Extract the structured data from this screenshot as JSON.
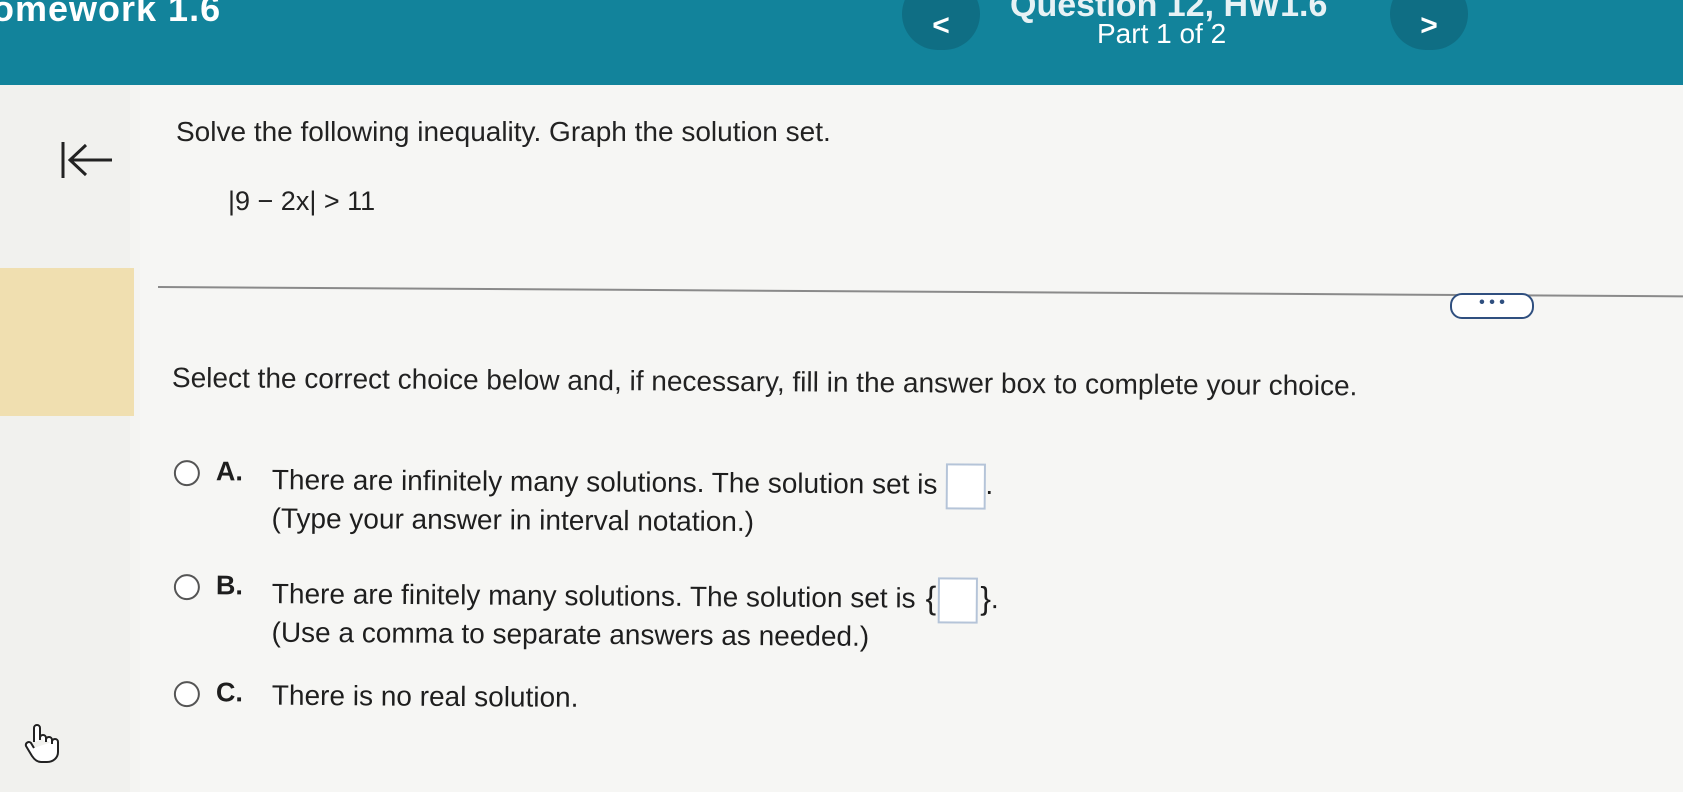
{
  "header": {
    "assignment_title": "omework 1.6",
    "question_title": "Question 12, HW1.6",
    "part_label": "Part 1 of 2",
    "prev_label": "<",
    "next_label": ">"
  },
  "sidebar": {
    "back_icon": "collapse-left-arrow-icon",
    "hand_icon": "hand-pointer-icon"
  },
  "problem": {
    "instruction": "Solve the following inequality. Graph the solution set.",
    "equation": "|9 − 2x| > 11"
  },
  "more_button_label": "• • •",
  "prompt": "Select the correct choice below and, if necessary, fill in the answer box to complete your choice.",
  "choices": [
    {
      "letter": "A.",
      "text": "There are infinitely many solutions. The solution set is",
      "hint": "(Type your answer in interval notation.)",
      "answer_value": ""
    },
    {
      "letter": "B.",
      "text": "There are finitely many solutions. The solution set is",
      "hint": "(Use a comma to separate answers as needed.)",
      "answer_value": ""
    },
    {
      "letter": "C.",
      "text": "There is no real solution."
    }
  ],
  "colors": {
    "header": "#12839b",
    "sidebar_highlight": "#f0dfb0"
  }
}
